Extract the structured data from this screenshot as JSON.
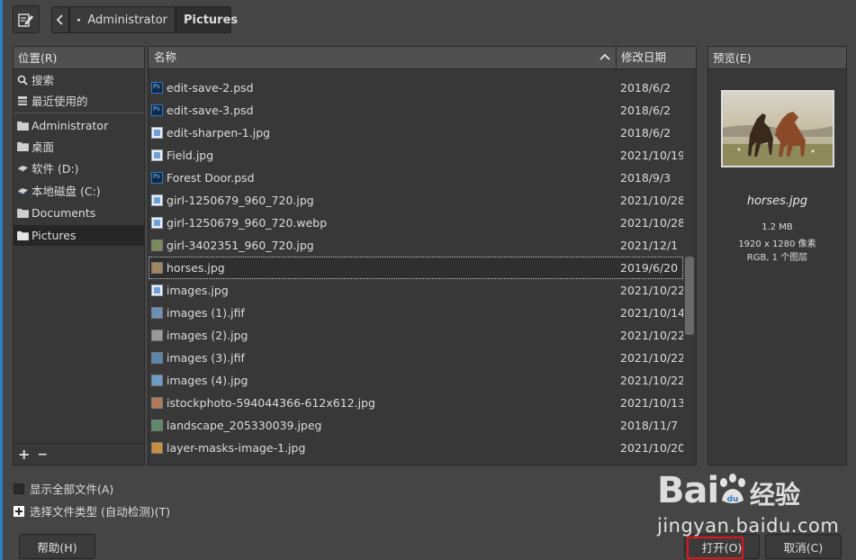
{
  "toolbar": {
    "edit_icon": "edit-location-icon",
    "back_icon": "chevron-left-icon",
    "breadcrumb": [
      {
        "label": "Administrator",
        "icon": "folder-icon"
      },
      {
        "label": "Pictures"
      }
    ]
  },
  "places": {
    "header": "位置(R)",
    "items": [
      {
        "label": "搜索",
        "icon": "search-icon"
      },
      {
        "label": "最近使用的",
        "icon": "recent-icon"
      },
      {
        "label": "Administrator",
        "icon": "folder-icon"
      },
      {
        "label": "桌面",
        "icon": "folder-icon"
      },
      {
        "label": "软件 (D:)",
        "icon": "drive-icon"
      },
      {
        "label": "本地磁盘 (C:)",
        "icon": "drive-icon"
      },
      {
        "label": "Documents",
        "icon": "folder-icon"
      },
      {
        "label": "Pictures",
        "icon": "folder-icon",
        "selected": true
      }
    ],
    "add_label": "+",
    "remove_label": "−"
  },
  "filelist": {
    "col_name": "名称",
    "col_date": "修改日期",
    "files": [
      {
        "name": "edit-save-2.psd",
        "date": "2018/6/2",
        "type": "psd"
      },
      {
        "name": "edit-save-3.psd",
        "date": "2018/6/2",
        "type": "psd"
      },
      {
        "name": "edit-sharpen-1.jpg",
        "date": "2018/6/2",
        "type": "doc"
      },
      {
        "name": "Field.jpg",
        "date": "2021/10/19",
        "type": "doc"
      },
      {
        "name": "Forest Door.psd",
        "date": "2018/9/3",
        "type": "psd"
      },
      {
        "name": "girl-1250679_960_720.jpg",
        "date": "2021/10/28",
        "type": "doc"
      },
      {
        "name": "girl-1250679_960_720.webp",
        "date": "2021/10/28",
        "type": "doc"
      },
      {
        "name": "girl-3402351_960_720.jpg",
        "date": "2021/12/1",
        "type": "thumb",
        "color": "#7a8a5a"
      },
      {
        "name": "horses.jpg",
        "date": "2019/6/20",
        "type": "thumb",
        "color": "#a08560",
        "selected": true
      },
      {
        "name": "images.jpg",
        "date": "2021/10/22",
        "type": "doc"
      },
      {
        "name": "images (1).jfif",
        "date": "2021/10/14",
        "type": "thumb",
        "color": "#6c90b8"
      },
      {
        "name": "images (2).jpg",
        "date": "2021/10/22",
        "type": "thumb",
        "color": "#9a9a9a"
      },
      {
        "name": "images (3).jfif",
        "date": "2021/10/22",
        "type": "thumb",
        "color": "#5c84b0"
      },
      {
        "name": "images (4).jpg",
        "date": "2021/10/22",
        "type": "thumb",
        "color": "#6e9cc8"
      },
      {
        "name": "istockphoto-594044366-612x612.jpg",
        "date": "2021/10/13",
        "type": "thumb",
        "color": "#b07a58"
      },
      {
        "name": "landscape_205330039.jpeg",
        "date": "2018/11/7",
        "type": "thumb",
        "color": "#5f8a6a"
      },
      {
        "name": "layer-masks-image-1.jpg",
        "date": "2021/10/20",
        "type": "thumb",
        "color": "#c89040"
      }
    ]
  },
  "preview": {
    "header": "预览(E)",
    "filename": "horses.jpg",
    "size": "1.2 MB",
    "dimensions": "1920 x 1280 像素",
    "mode": "RGB, 1 个图层"
  },
  "options": {
    "show_all": "显示全部文件(A)",
    "select_type": "选择文件类型 (自动检测)(T)"
  },
  "buttons": {
    "help": "帮助(H)",
    "open": "打开(O)",
    "cancel": "取消(C)"
  },
  "watermark": {
    "logo": "Bai",
    "logo_suffix": "经验",
    "url": "jingyan.baidu.com"
  }
}
